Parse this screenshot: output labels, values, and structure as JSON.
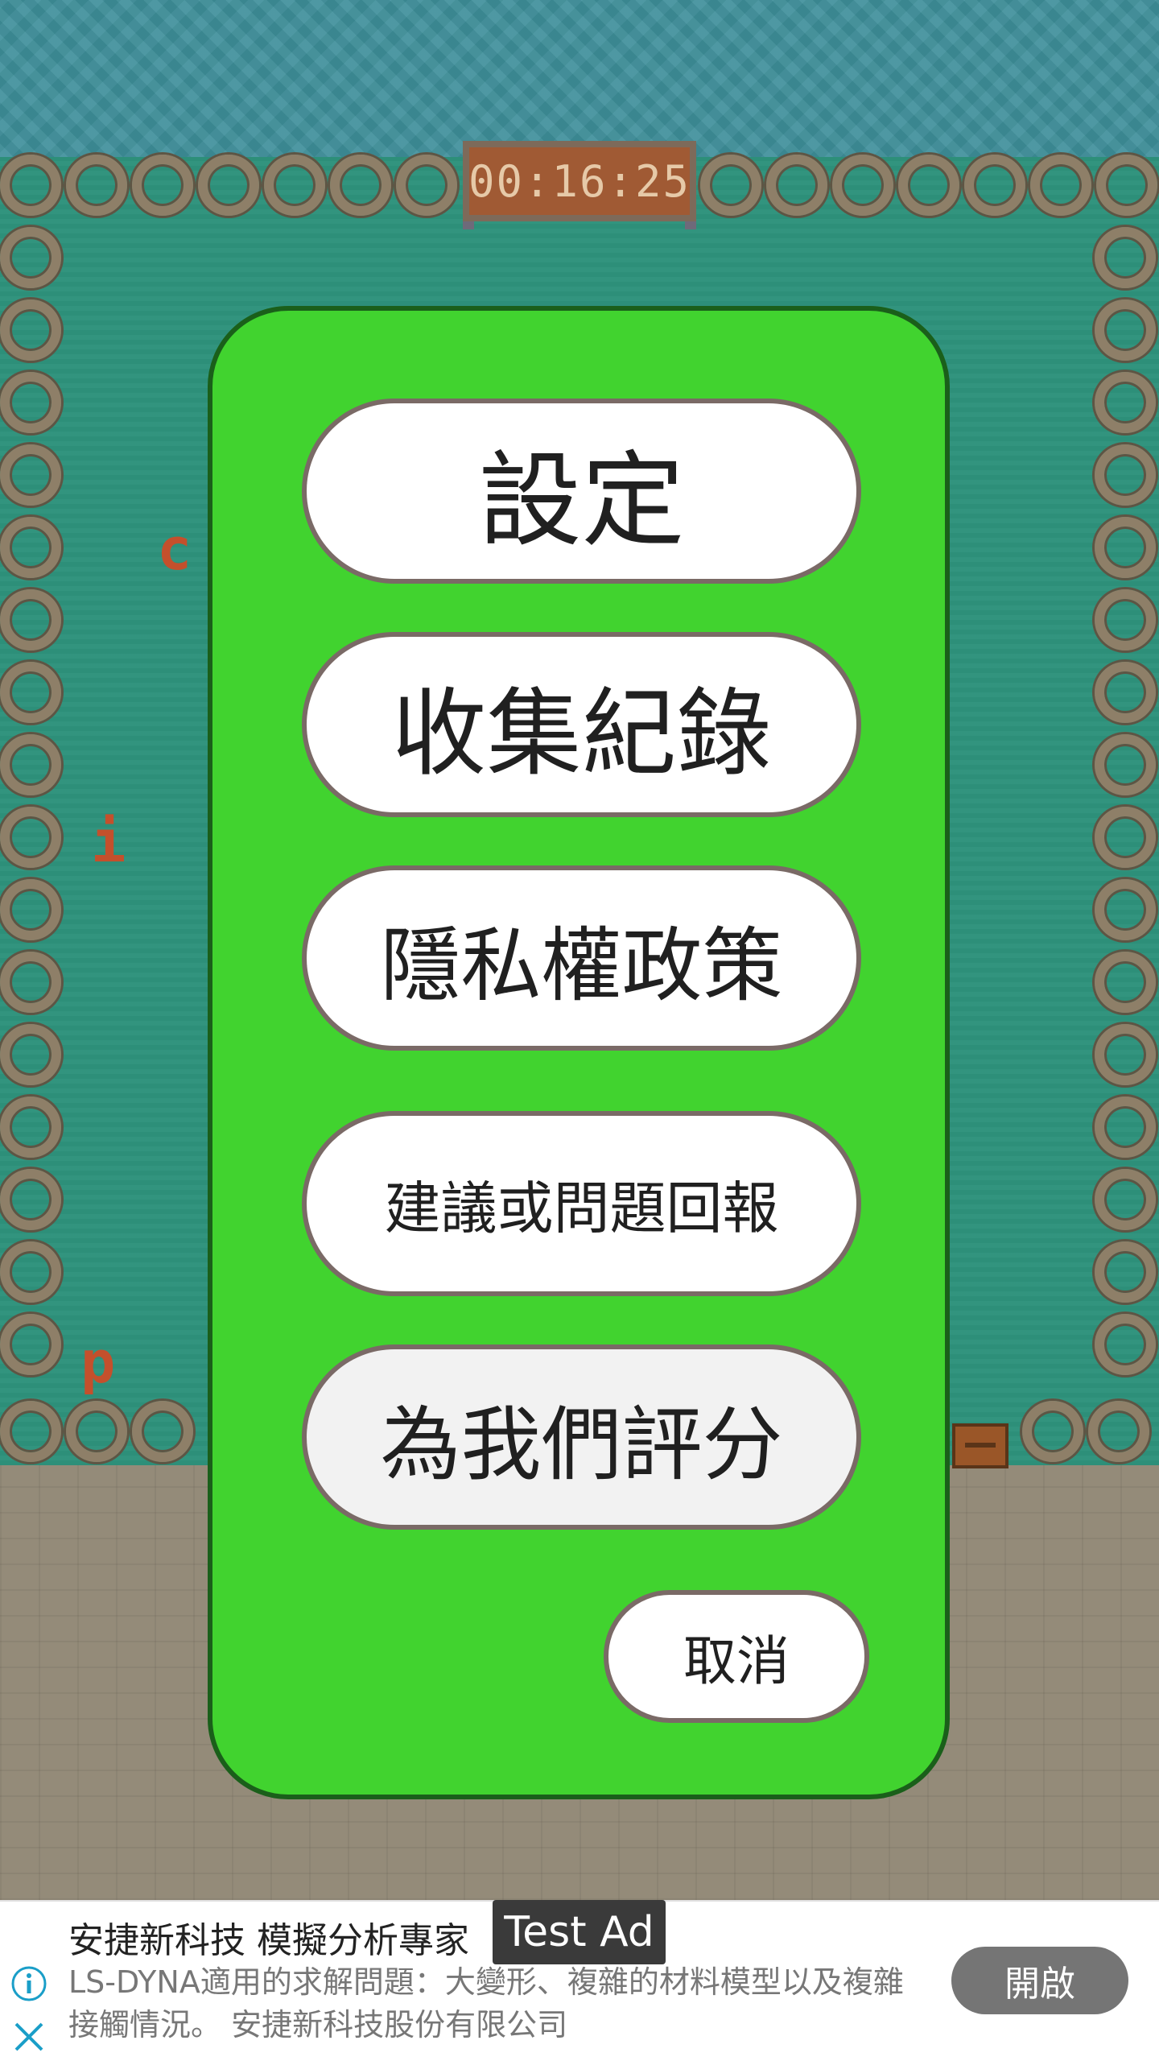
{
  "game": {
    "timer": "00:16:25",
    "letters": [
      "c",
      "i",
      "p"
    ]
  },
  "menu": {
    "buttons": [
      {
        "label": "設定"
      },
      {
        "label": "收集紀錄"
      },
      {
        "label": "隱私權政策"
      },
      {
        "label": "建議或問題回報"
      },
      {
        "label": "為我們評分"
      }
    ],
    "cancel_label": "取消"
  },
  "ad": {
    "title": "安捷新科技 模擬分析專家",
    "badge": "Test Ad",
    "body": "LS-DYNA適用的求解問題：大變形、複雜的材料模型以及複雜接觸情況。 安捷新科技股份有限公司",
    "open_label": "開啟",
    "icons": [
      "info-icon",
      "close-icon"
    ]
  },
  "colors": {
    "menu_bg": "#41d32f",
    "ad_accent": "#1a9ec8"
  }
}
